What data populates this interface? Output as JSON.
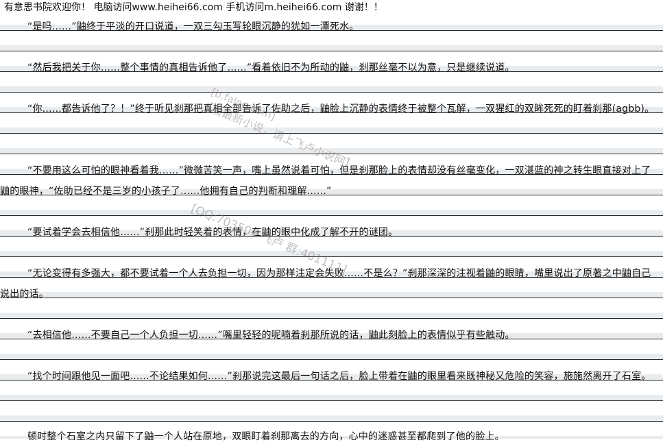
{
  "header": {
    "text": "有意思书院欢迎你！  电脑访问www.heihei66.com   手机访问m.heihei66.com  谢谢！！"
  },
  "paragraphs": [
    "“是吗……”鼬终于平淡的开口说道，一双三勾玉写轮眼沉静的犹如一潭死水。",
    "“然后我把关于你……整个事情的真相告诉他了……”看着依旧不为所动的鼬，刹那丝毫不以为意，只是继续说道。",
    "“你……都告诉他了？！”终于听见刹那把真相全部告诉了佐助之后，鼬脸上沉静的表情终于被整个瓦解，一双猩红的双眸死死的盯着刹那(agbb)。",
    "“不要用这么可怕的眼神看着我……”微微苦笑一声，嘴上虽然说着可怕，但是刹那脸上的表情却没有丝毫变化，一双湛蓝的神之转生眼直接对上了鼬的眼神，“佐助已经不是三岁的小孩子了……他拥有自己的判断和理解……”",
    "“要试着学会去相信他……”刹那此时轻笑着的表情，在鼬的眼中化成了解不开的谜团。",
    "“无论变得有多强大，都不要试着一个人去负担一切，因为那样注定会失败……不是么？”刹那深深的注视着鼬的眼睛，嘴里说出了原著之中鼬自己说出的话。",
    "“去相信他……不要自己一个人负担一切……”嘴里轻轻的呢喃着刹那所说的话，鼬此刻脸上的表情似乎有些触动。",
    "“找个时间跟他见一面吧……不论结果如何……”刹那说完这最后一句话之后，脸上带着在鼬的眼里看来既神秘又危险的笑容，施施然离开了石室。",
    "顿时整个石室之内只留下了鼬一个人站在原地，双眼盯着刹那离去的方向，心中的迷惑甚至都爬到了他的脸上。"
  ],
  "watermarks": {
    "w1": "【看最新小说，请上飞卢小说网】",
    "w2": "[b.faloo.com]",
    "w3": "[QQ:703506 飞卢 群:401111]"
  }
}
